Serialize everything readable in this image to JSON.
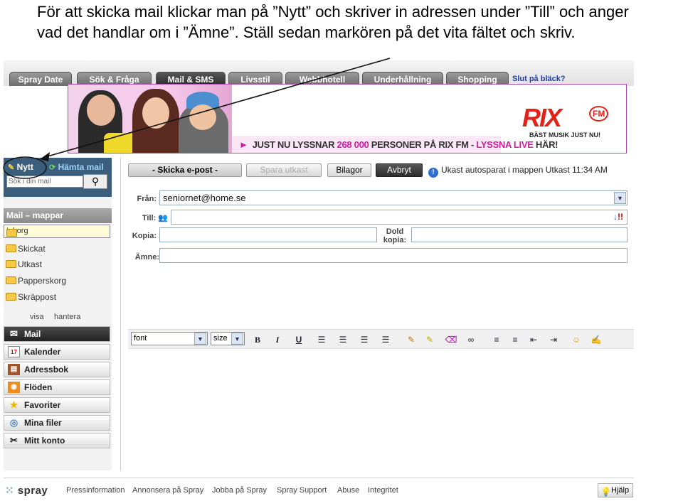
{
  "instruction": {
    "line1": "För att skicka mail klickar man på ”Nytt” och skriver in adressen under ”Till” och anger",
    "line2": "vad det handlar om i ”Ämne”. Ställ sedan markören på det vita fältet och skriv."
  },
  "tabs": [
    "Spray Date",
    "Sök & Fråga",
    "Mail & SMS",
    "Livsstil",
    "Webbhotell",
    "Underhållning",
    "Shopping"
  ],
  "tab_link": "Slut på bläck?",
  "banner": {
    "arrow": "►",
    "text_a": "JUST NU LYSSNAR",
    "count": "268 000",
    "text_b": "PERSONER PÅ RIX FM -",
    "text_c": "LYSSNA LIVE",
    "text_d": "HÄR!",
    "logo": "RIX",
    "logo_fm": "FM",
    "tagline": "BÄST MUSIK JUST NU!"
  },
  "sidebar": {
    "nytt": "Nytt",
    "hamta": "Hämta mail",
    "search_placeholder": "Sök i din mail",
    "search_icon": "magnifier-icon",
    "folders_title": "Mail – mappar",
    "folders": [
      "Inkorg",
      "Skickat",
      "Utkast",
      "Papperskorg",
      "Skräppost"
    ],
    "visa": "visa",
    "hantera": "hantera",
    "nav": [
      {
        "label": "Mail",
        "icon": "envelope-icon"
      },
      {
        "label": "Kalender",
        "icon": "calendar-icon",
        "icon_text": "17"
      },
      {
        "label": "Adressbok",
        "icon": "addressbook-icon"
      },
      {
        "label": "Flöden",
        "icon": "rss-icon"
      },
      {
        "label": "Favoriter",
        "icon": "star-icon"
      },
      {
        "label": "Mina filer",
        "icon": "disc-icon"
      },
      {
        "label": "Mitt konto",
        "icon": "tools-icon"
      }
    ]
  },
  "compose": {
    "send": "- Skicka e-post -",
    "save_draft": "Spara utkast",
    "attachments": "Bilagor",
    "cancel": "Avbryt",
    "autosave": "Ukast autosparat i mappen Utkast 11:34 AM",
    "labels": {
      "from": "Från:",
      "to": "Till:",
      "cc": "Kopia:",
      "bcc_1": "Dold",
      "bcc_2": "kopia:",
      "subject": "Ämne:"
    },
    "from_value": "seniornet@home.se",
    "to_value": "",
    "cc_value": "",
    "bcc_value": "",
    "subject_value": "",
    "priority_mark": "!",
    "toolbar": {
      "font": "font",
      "size": "size",
      "bold": "B",
      "italic": "I",
      "underline": "U"
    }
  },
  "footer": {
    "logo": "spray",
    "links": [
      "Pressinformation",
      "Annonsera på Spray",
      "Jobba på Spray",
      "Spray Support",
      "Abuse",
      "Integritet"
    ],
    "help": "Hjälp"
  }
}
